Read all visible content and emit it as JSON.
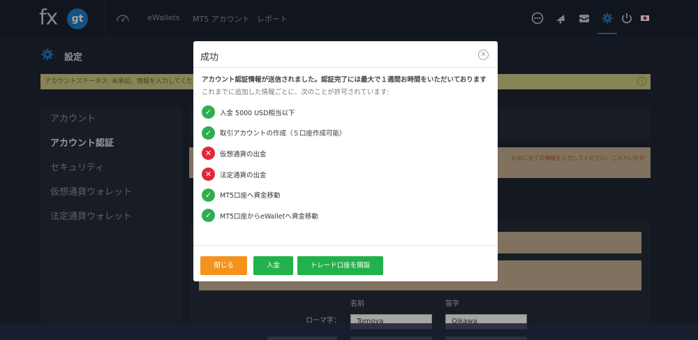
{
  "header": {
    "logo_fx": "fx",
    "logo_gt": "gt",
    "nav": [
      "eWallets",
      "MT5 アカウント",
      "レポート"
    ]
  },
  "page": {
    "title": "設定",
    "status_text": "アカウントステータス: 未承認。情報を入力してください。"
  },
  "sidebar": {
    "items": [
      {
        "label": "アカウント"
      },
      {
        "label": "アカウント認証"
      },
      {
        "label": "セキュリティ"
      },
      {
        "label": "仮想通貨ウォレット"
      },
      {
        "label": "法定通貨ウォレット"
      }
    ]
  },
  "main": {
    "warning_text": "ために全ての情報を入力してください。ご入力いただ",
    "name_header": "名前",
    "surname_header": "苗字",
    "romaji_label": "ローマ字：",
    "name_value": "Tomoya",
    "surname_value": "Oikawa"
  },
  "modal": {
    "title": "成功",
    "message": "アカウント認証情報が送信されました。認証完了には最大で１週間お時間をいただいております",
    "subtitle": "これまでに追加した情報ごとに、次のことが許可されています:",
    "permissions": [
      {
        "label": "入金 5000 USD相当以下",
        "allowed": true
      },
      {
        "label": "取引アカウントの作成（５口座作成可能）",
        "allowed": true
      },
      {
        "label": "仮想通貨の出金",
        "allowed": false
      },
      {
        "label": "法定通貨の出金",
        "allowed": false
      },
      {
        "label": "MT5口座へ資金移動",
        "allowed": true
      },
      {
        "label": "MT5口座からeWalletへ資金移動",
        "allowed": true
      }
    ],
    "buttons": {
      "close": "閉じる",
      "deposit": "入金",
      "open_trade": "トレード口座を開設"
    }
  },
  "colors": {
    "accent": "#1f7ec6",
    "orange": "#f5921e",
    "green": "#21b24b",
    "red": "#e3263a",
    "status_yellow": "#cfcb86"
  }
}
